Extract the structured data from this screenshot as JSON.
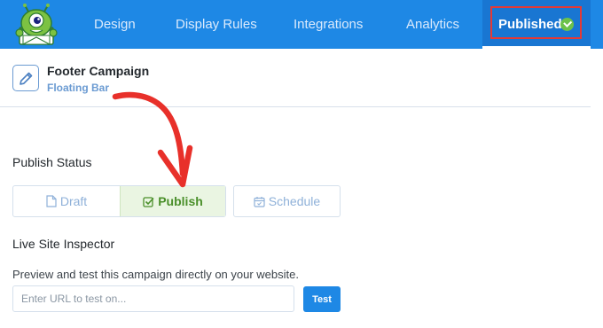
{
  "nav": {
    "tabs": [
      "Design",
      "Display Rules",
      "Integrations",
      "Analytics"
    ],
    "published_label": "Published",
    "logo_icon": "optinmonster-mascot-logo",
    "active_tab": "Published",
    "accent": "#1e88e5"
  },
  "campaign": {
    "name": "Footer Campaign",
    "type": "Floating Bar",
    "edit_icon": "pencil-icon"
  },
  "publish_status": {
    "label": "Publish Status",
    "options": [
      {
        "label": "Draft",
        "icon": "document-icon",
        "selected": false
      },
      {
        "label": "Publish",
        "icon": "checkbox-icon",
        "selected": true
      },
      {
        "label": "Schedule",
        "icon": "calendar-icon",
        "selected": false
      }
    ]
  },
  "inspector": {
    "label": "Live Site Inspector",
    "description": "Preview and test this campaign directly on your website.",
    "url_value": "",
    "url_placeholder": "Enter URL to test on...",
    "test_label": "Test"
  },
  "colors": {
    "nav_bg": "#1e88e5",
    "highlight_border": "#e53935",
    "success_green": "#6cc24a",
    "annotation_arrow": "#e8302a"
  }
}
